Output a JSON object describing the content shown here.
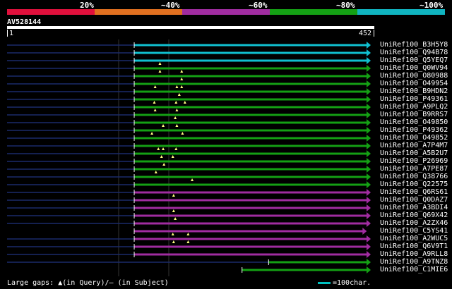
{
  "legend": {
    "labels": [
      "20%",
      "~40%",
      "~60%",
      "~80%",
      "~100%"
    ],
    "colors": [
      "#e0103c",
      "#e07020",
      "#a02ca0",
      "#14a014",
      "#10b4c0"
    ]
  },
  "query": {
    "name": "AV528144",
    "start": "1",
    "end": "452",
    "length": 452
  },
  "hits": [
    {
      "name": "UniRef100_B3H5Y8",
      "color": "#10c0d0",
      "start": 158,
      "end": 452,
      "pre": [
        [
          0,
          158
        ]
      ],
      "marks": []
    },
    {
      "name": "UniRef100_Q94B78",
      "color": "#10c0d0",
      "start": 158,
      "end": 452,
      "pre": [
        [
          0,
          158
        ]
      ],
      "marks": []
    },
    {
      "name": "UniRef100_Q5YEQ7",
      "color": "#10c0d0",
      "start": 158,
      "end": 452,
      "pre": [
        [
          0,
          158
        ]
      ],
      "marks": []
    },
    {
      "name": "UniRef100_Q0WV94",
      "color": "#14a014",
      "start": 158,
      "end": 452,
      "pre": [
        [
          0,
          158
        ]
      ],
      "marks": [
        190
      ]
    },
    {
      "name": "UniRef100_O80988",
      "color": "#14a014",
      "start": 158,
      "end": 452,
      "pre": [
        [
          0,
          158
        ]
      ],
      "marks": [
        190,
        217
      ]
    },
    {
      "name": "UniRef100_O49954",
      "color": "#14a014",
      "start": 158,
      "end": 452,
      "pre": [
        [
          0,
          158
        ]
      ],
      "marks": [
        217
      ]
    },
    {
      "name": "UniRef100_B9HDN2",
      "color": "#14a014",
      "start": 158,
      "end": 452,
      "pre": [
        [
          0,
          158
        ]
      ],
      "marks": [
        184,
        211,
        217
      ]
    },
    {
      "name": "UniRef100_P49361",
      "color": "#14a014",
      "start": 158,
      "end": 452,
      "pre": [
        [
          0,
          158
        ]
      ],
      "marks": [
        214
      ]
    },
    {
      "name": "UniRef100_A9PLQ2",
      "color": "#14a014",
      "start": 158,
      "end": 452,
      "pre": [
        [
          0,
          158
        ]
      ],
      "marks": [
        183,
        210,
        221
      ]
    },
    {
      "name": "UniRef100_B9RRS7",
      "color": "#14a014",
      "start": 158,
      "end": 452,
      "pre": [
        [
          0,
          158
        ]
      ],
      "marks": [
        184,
        211
      ]
    },
    {
      "name": "UniRef100_O49850",
      "color": "#14a014",
      "start": 158,
      "end": 452,
      "pre": [
        [
          0,
          158
        ]
      ],
      "marks": [
        209
      ]
    },
    {
      "name": "UniRef100_P49362",
      "color": "#14a014",
      "start": 158,
      "end": 452,
      "pre": [
        [
          0,
          158
        ]
      ],
      "marks": [
        194,
        211
      ]
    },
    {
      "name": "UniRef100_O49852",
      "color": "#14a014",
      "start": 158,
      "end": 452,
      "pre": [
        [
          0,
          158
        ]
      ],
      "marks": [
        180,
        218
      ]
    },
    {
      "name": "UniRef100_A7P4M7",
      "color": "#14a014",
      "start": 158,
      "end": 452,
      "pre": [
        [
          0,
          158
        ]
      ],
      "marks": []
    },
    {
      "name": "UniRef100_A5B2U7",
      "color": "#14a014",
      "start": 158,
      "end": 452,
      "pre": [
        [
          0,
          158
        ]
      ],
      "marks": [
        188,
        194,
        210
      ]
    },
    {
      "name": "UniRef100_P26969",
      "color": "#14a014",
      "start": 158,
      "end": 452,
      "pre": [
        [
          0,
          158
        ]
      ],
      "marks": [
        192,
        206
      ]
    },
    {
      "name": "UniRef100_A7PE87",
      "color": "#14a014",
      "start": 158,
      "end": 452,
      "pre": [
        [
          0,
          158
        ]
      ],
      "marks": [
        195
      ]
    },
    {
      "name": "UniRef100_Q38766",
      "color": "#14a014",
      "start": 158,
      "end": 452,
      "pre": [
        [
          0,
          158
        ]
      ],
      "marks": [
        185
      ]
    },
    {
      "name": "UniRef100_Q22575",
      "color": "#14a014",
      "start": 158,
      "end": 452,
      "pre": [
        [
          0,
          158
        ]
      ],
      "marks": [
        230
      ]
    },
    {
      "name": "UniRef100_Q6RS61",
      "color": "#a02ca0",
      "start": 158,
      "end": 452,
      "pre": [
        [
          0,
          158
        ]
      ],
      "marks": []
    },
    {
      "name": "UniRef100_Q0DAZ7",
      "color": "#a02ca0",
      "start": 158,
      "end": 452,
      "pre": [
        [
          0,
          158
        ]
      ],
      "marks": [
        207
      ]
    },
    {
      "name": "UniRef100_A3BDI4",
      "color": "#a02ca0",
      "start": 158,
      "end": 452,
      "pre": [
        [
          0,
          158
        ]
      ],
      "marks": []
    },
    {
      "name": "UniRef100_Q69X42",
      "color": "#a02ca0",
      "start": 158,
      "end": 452,
      "pre": [
        [
          0,
          158
        ]
      ],
      "marks": [
        207
      ]
    },
    {
      "name": "UniRef100_A2ZX46",
      "color": "#a02ca0",
      "start": 158,
      "end": 452,
      "pre": [
        [
          0,
          158
        ]
      ],
      "marks": [
        209
      ]
    },
    {
      "name": "UniRef100_C5YS41",
      "color": "#a02ca0",
      "start": 158,
      "end": 447,
      "pre": [],
      "marks": []
    },
    {
      "name": "UniRef100_A2WUC5",
      "color": "#a02ca0",
      "start": 158,
      "end": 452,
      "pre": [
        [
          0,
          158
        ]
      ],
      "marks": [
        206,
        225
      ]
    },
    {
      "name": "UniRef100_Q6V9T1",
      "color": "#a02ca0",
      "start": 158,
      "end": 452,
      "pre": [
        [
          0,
          158
        ]
      ],
      "marks": [
        207,
        225
      ]
    },
    {
      "name": "UniRef100_A9RLL8",
      "color": "#a02ca0",
      "start": 158,
      "end": 452,
      "pre": [
        [
          0,
          158
        ]
      ],
      "marks": []
    },
    {
      "name": "UniRef100_A9TNZ8",
      "color": "#14a014",
      "start": 325,
      "end": 452,
      "pre": [
        [
          0,
          325
        ]
      ],
      "marks": []
    },
    {
      "name": "UniRef100_C1MIE6",
      "color": "#14a014",
      "start": 292,
      "end": 452,
      "pre": [],
      "marks": []
    }
  ],
  "footer": {
    "gaps_text": "Large gaps: ▲(in Query)/— (in Subject)",
    "scale_text": "=100char."
  }
}
